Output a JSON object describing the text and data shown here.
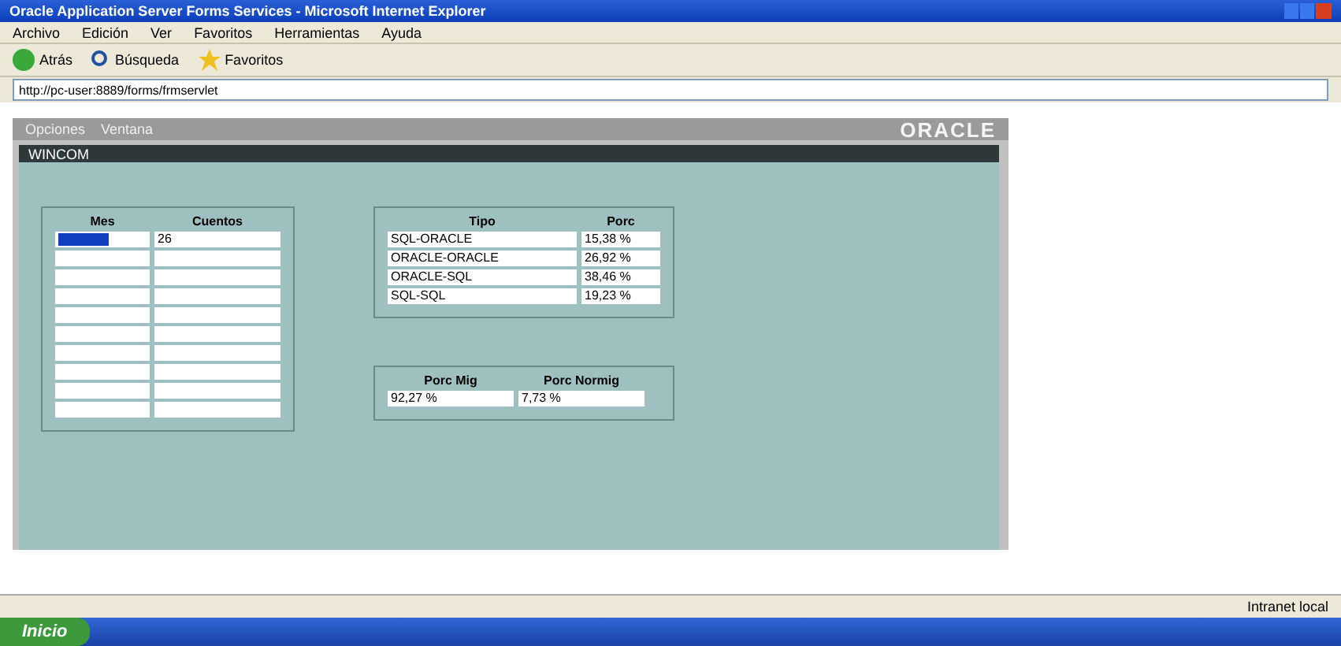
{
  "window": {
    "title": "Oracle Application Server Forms Services - Microsoft Internet Explorer"
  },
  "menu": [
    "Archivo",
    "Edición",
    "Ver",
    "Favoritos",
    "Herramientas",
    "Ayuda"
  ],
  "toolbar": {
    "back": "Atrás",
    "search": "Búsqueda",
    "favorites": "Favoritos"
  },
  "address": {
    "value": "http://pc-user:8889/forms/frmservlet"
  },
  "applet": {
    "menu": [
      "Opciones",
      "Ventana"
    ],
    "logo": "ORACLE",
    "form_title": "WINCOM",
    "group_1": {
      "columns": [
        "Mes",
        "Cuentos"
      ],
      "rows": [
        {
          "cells": [
            "",
            "26"
          ],
          "selected": true
        },
        {
          "cells": [
            "",
            ""
          ],
          "selected": false
        },
        {
          "cells": [
            "",
            ""
          ],
          "selected": false
        },
        {
          "cells": [
            "",
            ""
          ],
          "selected": false
        },
        {
          "cells": [
            "",
            ""
          ],
          "selected": false
        },
        {
          "cells": [
            "",
            ""
          ],
          "selected": false
        },
        {
          "cells": [
            "",
            ""
          ],
          "selected": false
        },
        {
          "cells": [
            "",
            ""
          ],
          "selected": false
        },
        {
          "cells": [
            "",
            ""
          ],
          "selected": false
        },
        {
          "cells": [
            "",
            ""
          ],
          "selected": false
        }
      ]
    },
    "group_2": {
      "columns": [
        "Tipo",
        "Porc"
      ],
      "rows": [
        [
          "SQL-ORACLE",
          "15,38 %"
        ],
        [
          "ORACLE-ORACLE",
          "26,92 %"
        ],
        [
          "ORACLE-SQL",
          "38,46 %"
        ],
        [
          "SQL-SQL",
          "19,23 %"
        ]
      ]
    },
    "group_3": {
      "columns": [
        "Porc Mig",
        "Porc Normig"
      ],
      "values": [
        "92,27 %",
        "7,73 %"
      ]
    }
  },
  "status_bar": {
    "zone": "Intranet local"
  },
  "taskbar": {
    "start": "Inicio"
  }
}
